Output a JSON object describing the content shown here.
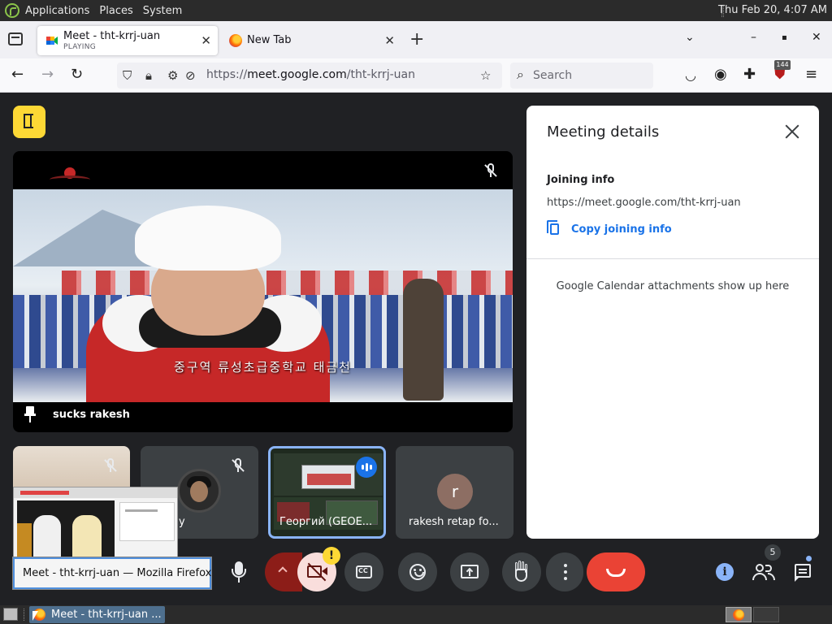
{
  "top_panel": {
    "menus": [
      "Applications",
      "Places",
      "System"
    ],
    "clock": "Thu Feb 20,  4:07 AM"
  },
  "tabs": [
    {
      "title": "Meet - tht-krrj-uan",
      "subtitle": "PLAYING",
      "icon": "google-meet-icon"
    },
    {
      "title": "New Tab",
      "icon": "firefox-icon"
    }
  ],
  "window_controls": {
    "list": "⌄",
    "minimize": "–",
    "maximize": "▪",
    "close": "✕"
  },
  "navbar": {
    "url_prefix": "https://",
    "url_host": "meet.google.com",
    "url_path": "/tht-krrj-uan",
    "search_placeholder": "Search",
    "extension_badge": "144"
  },
  "main_tile": {
    "participant_name": "sucks rakesh",
    "subtitle_overlay": "중구역 류성초급중학교 태금천"
  },
  "thumbnails": [
    {
      "name": ""
    },
    {
      "name": "y"
    },
    {
      "name": "Георгий (GEOE..."
    },
    {
      "name": "rakesh retap fo...",
      "avatar_letter": "r"
    }
  ],
  "tooltip": "Meet - tht-krrj-uan — Mozilla Firefox",
  "controls": {
    "warning_badge": "!",
    "people_count": "5",
    "info_label": "i"
  },
  "meeting_details": {
    "title": "Meeting details",
    "joining_info_label": "Joining info",
    "meeting_url": "https://meet.google.com/tht-krrj-uan",
    "copy_label": "Copy joining info",
    "calendar_note": "Google Calendar attachments show up here"
  },
  "taskbar": {
    "task_label": "Meet - tht-krrj-uan ..."
  },
  "colors": {
    "meet_bg": "#202124",
    "leave_red": "#ea4335",
    "accent_blue": "#1a73e8",
    "yellow": "#fdd835"
  }
}
